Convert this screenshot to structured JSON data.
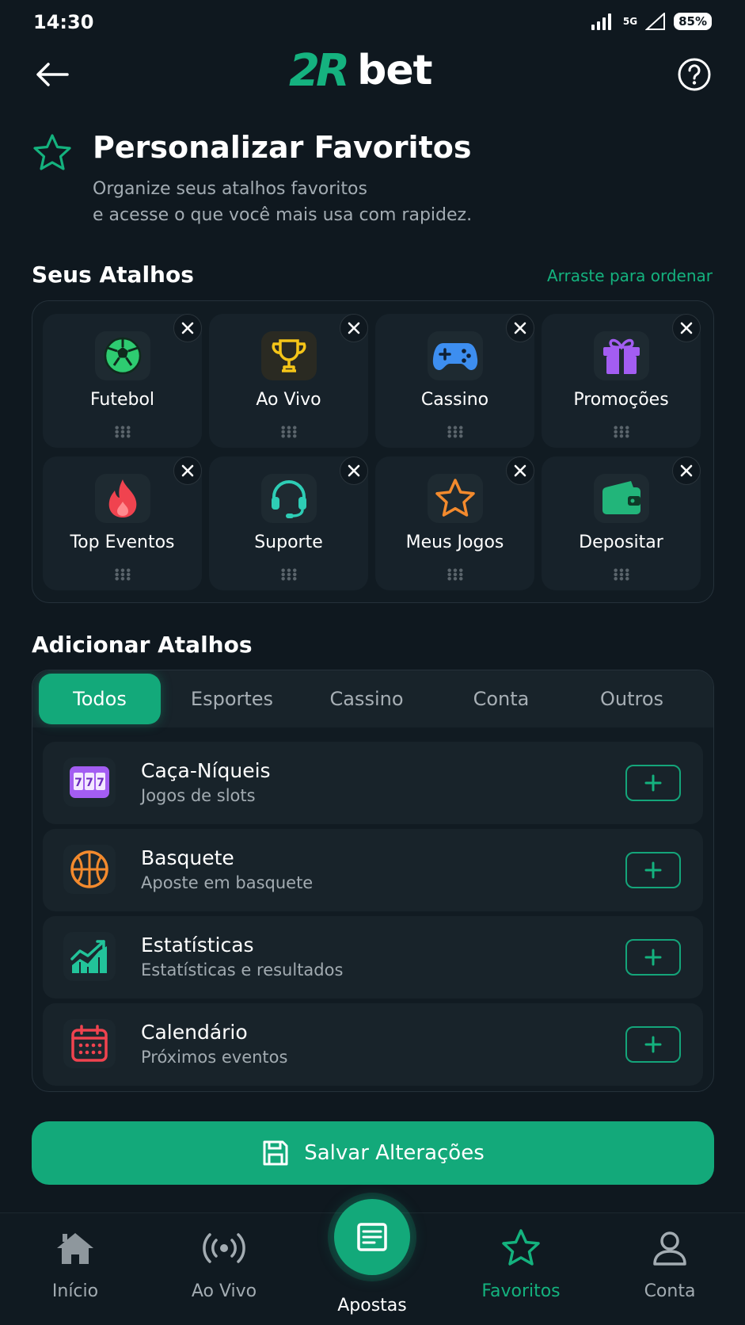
{
  "status_bar": {
    "time": "14:30",
    "network_label": "5G",
    "battery": "85%"
  },
  "header": {
    "logo_mark": "2R",
    "logo_text": "bet"
  },
  "title": {
    "heading": "Personalizar Favoritos",
    "subtitle_line1": "Organize seus atalhos favoritos",
    "subtitle_line2": "e acesse o que você mais usa com rapidez."
  },
  "shortcuts": {
    "section_title": "Seus Atalhos",
    "drag_hint": "Arraste para ordenar",
    "items": [
      {
        "label": "Futebol",
        "icon": "soccer-ball-icon",
        "color": "#2ecc71"
      },
      {
        "label": "Ao Vivo",
        "icon": "trophy-icon",
        "color": "#f5c518"
      },
      {
        "label": "Cassino",
        "icon": "gamepad-icon",
        "color": "#3d8ef0"
      },
      {
        "label": "Promoções",
        "icon": "gift-icon",
        "color": "#a35df2"
      },
      {
        "label": "Top Eventos",
        "icon": "fire-icon",
        "color": "#f0434f"
      },
      {
        "label": "Suporte",
        "icon": "headset-icon",
        "color": "#2ecdb5"
      },
      {
        "label": "Meus Jogos",
        "icon": "star-icon",
        "color": "#f38a2d"
      },
      {
        "label": "Depositar",
        "icon": "wallet-icon",
        "color": "#22b57a"
      }
    ]
  },
  "add_shortcuts": {
    "section_title": "Adicionar Atalhos",
    "tabs": [
      {
        "label": "Todos",
        "active": true
      },
      {
        "label": "Esportes",
        "active": false
      },
      {
        "label": "Cassino",
        "active": false
      },
      {
        "label": "Conta",
        "active": false
      },
      {
        "label": "Outros",
        "active": false
      }
    ],
    "items": [
      {
        "title": "Caça-Níqueis",
        "subtitle": "Jogos de slots",
        "icon": "slot-machine-icon",
        "color": "#a35df2"
      },
      {
        "title": "Basquete",
        "subtitle": "Aposte em basquete",
        "icon": "basketball-icon",
        "color": "#f38a2d"
      },
      {
        "title": "Estatísticas",
        "subtitle": "Estatísticas e resultados",
        "icon": "chart-icon",
        "color": "#22c39a"
      },
      {
        "title": "Calendário",
        "subtitle": "Próximos eventos",
        "icon": "calendar-icon",
        "color": "#f0434f"
      }
    ]
  },
  "save_button": {
    "label": "Salvar Alterações"
  },
  "bottom_nav": {
    "items": [
      {
        "label": "Início",
        "icon": "home-icon",
        "active": false
      },
      {
        "label": "Ao Vivo",
        "icon": "live-broadcast-icon",
        "active": false
      },
      {
        "label": "Apostas",
        "icon": "betslip-icon",
        "active": false
      },
      {
        "label": "Favoritos",
        "icon": "star-icon",
        "active": true
      },
      {
        "label": "Conta",
        "icon": "user-icon",
        "active": false
      }
    ]
  },
  "colors": {
    "accent": "#13a97a",
    "background": "#0f181f",
    "card": "#17222a",
    "muted_text": "#a3acb3"
  }
}
